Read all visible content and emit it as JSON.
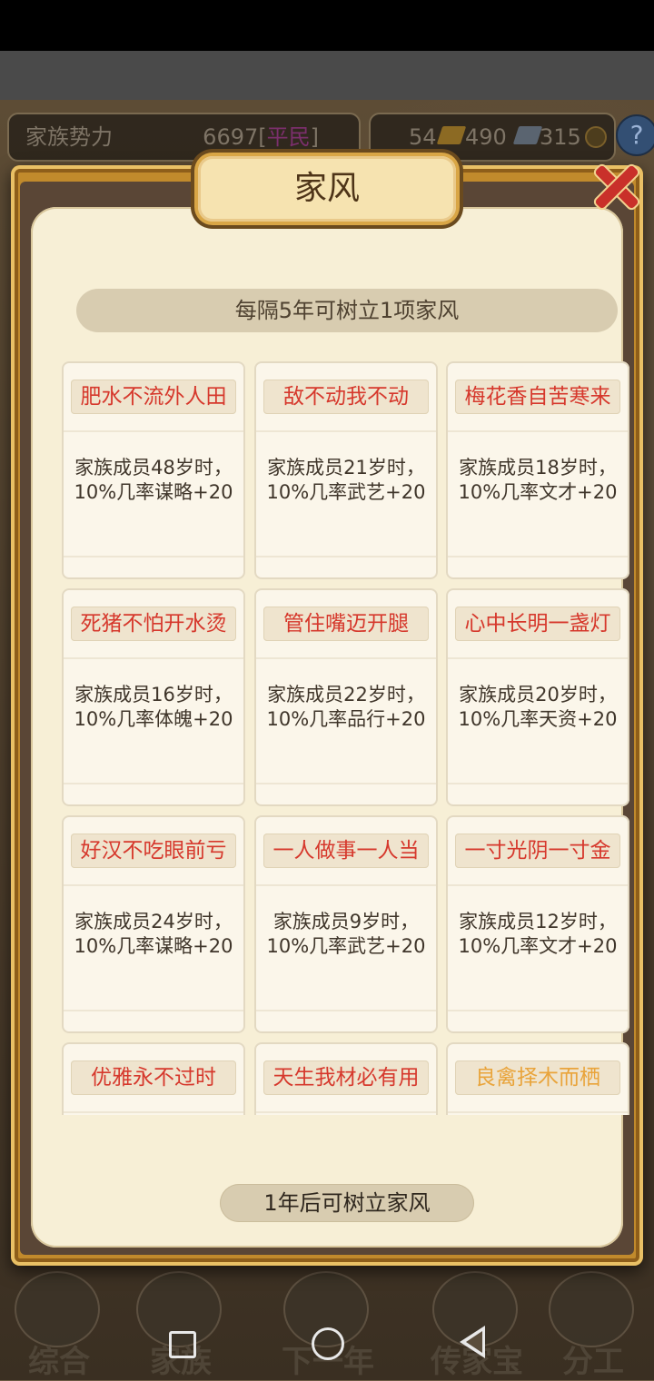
{
  "topbar": {
    "power_label": "家族势力",
    "power_value": "6697",
    "power_rank": "平民",
    "res1": "54",
    "res2": "490",
    "res3": "315",
    "help": "?"
  },
  "dialog": {
    "title": "家风",
    "banner": "每隔5年可树立1项家风",
    "button": "1年后可树立家风",
    "cards": [
      {
        "name": "肥水不流外人田",
        "desc": "家族成员48岁时，10%几率谋略+20"
      },
      {
        "name": "敌不动我不动",
        "desc": "家族成员21岁时，10%几率武艺+20"
      },
      {
        "name": "梅花香自苦寒来",
        "desc": "家族成员18岁时，10%几率文才+20"
      },
      {
        "name": "死猪不怕开水烫",
        "desc": "家族成员16岁时，10%几率体魄+20"
      },
      {
        "name": "管住嘴迈开腿",
        "desc": "家族成员22岁时，10%几率品行+20"
      },
      {
        "name": "心中长明一盏灯",
        "desc": "家族成员20岁时，10%几率天资+20"
      },
      {
        "name": "好汉不吃眼前亏",
        "desc": "家族成员24岁时，10%几率谋略+20"
      },
      {
        "name": "一人做事一人当",
        "desc": "家族成员9岁时，10%几率武艺+20"
      },
      {
        "name": "一寸光阴一寸金",
        "desc": "家族成员12岁时，10%几率文才+20"
      },
      {
        "name": "优雅永不过时",
        "desc": ""
      },
      {
        "name": "天生我材必有用",
        "desc": ""
      },
      {
        "name": "良禽择木而栖",
        "desc": ""
      }
    ]
  },
  "bottomnav": {
    "items": [
      "综合",
      "家族",
      "下一年",
      "传家宝",
      "分工"
    ]
  },
  "colors": {
    "name_red": "#d6382c",
    "name_gold": "#e9a43b",
    "frame_gold": "#c18a2c"
  }
}
